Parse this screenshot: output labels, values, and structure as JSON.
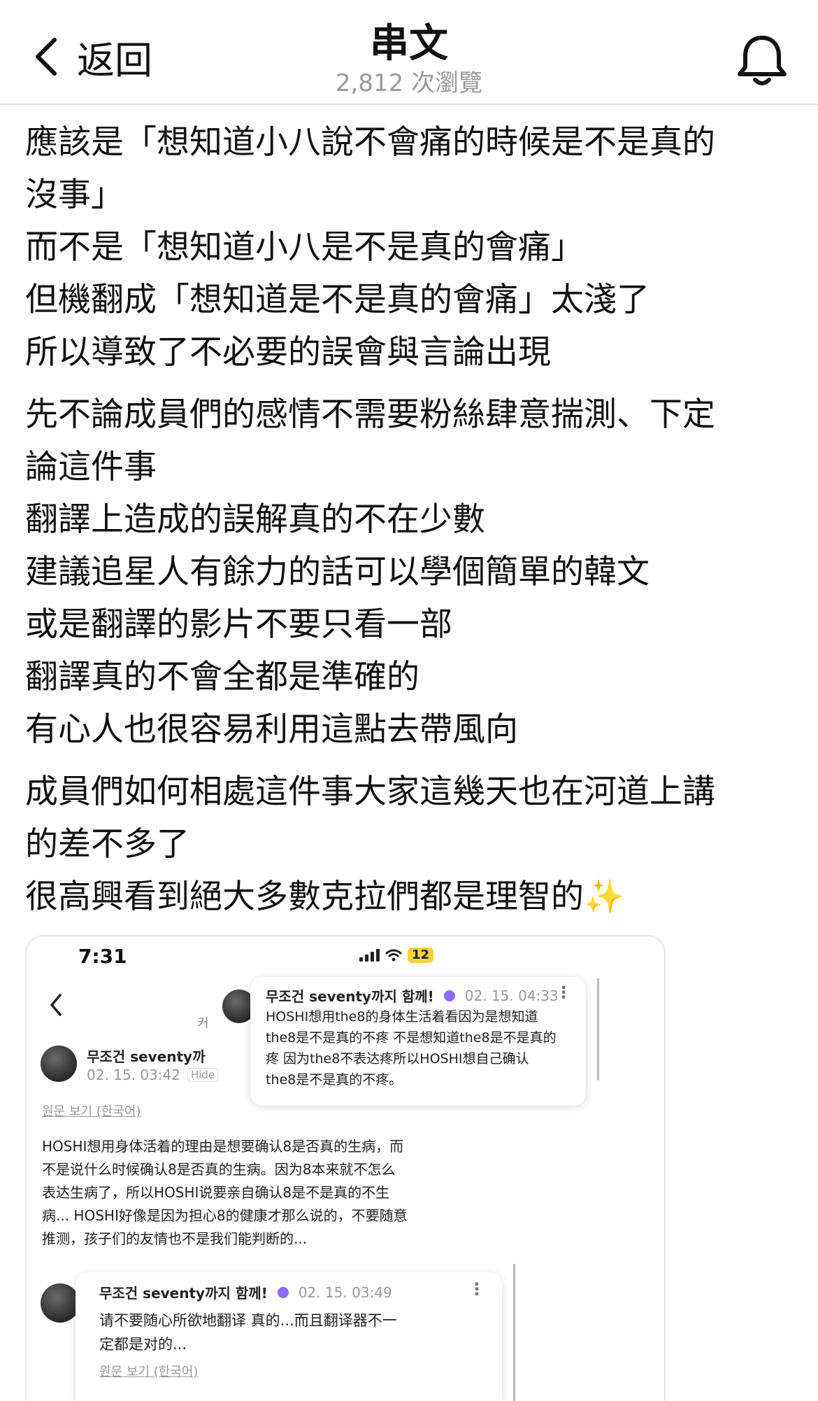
{
  "header": {
    "back_label": "返回",
    "title": "串文",
    "views": "2,812 次瀏覽"
  },
  "post": {
    "paragraphs": [
      [
        "應該是「想知道小八說不會痛的時候是不是真的",
        "沒事」",
        "而不是「想知道小八是不是真的會痛」",
        "但機翻成「想知道是不是真的會痛」太淺了",
        "所以導致了不必要的誤會與言論出現"
      ],
      [
        "先不論成員們的感情不需要粉絲肆意揣測、下定",
        "論這件事",
        "翻譯上造成的誤解真的不在少數",
        "建議追星人有餘力的話可以學個簡單的韓文",
        "或是翻譯的影片不要只看一部",
        "翻譯真的不會全都是準確的",
        "有心人也很容易利用這點去帶風向"
      ],
      [
        "成員們如何相處這件事大家這幾天也在河道上講",
        "的差不多了",
        "很高興看到絕大多數克拉們都是理智的"
      ]
    ],
    "sparkle_emoji": "✨"
  },
  "screenshot": {
    "time": "7:31",
    "battery": "12",
    "ghost_char": "커",
    "comment_left": {
      "name": "무조건 seventy까",
      "time": "02. 15. 03:42",
      "badge": "Hide"
    },
    "orig_link_1": "원문 보기 (한국어)",
    "reply_top": {
      "name": "무조건 seventy까지 함께!",
      "time": "02. 15. 04:33",
      "lines": [
        "HOSHI想用the8的身体生活着看因为是想知道",
        "the8是不是真的不疼  不是想知道the8是不是真的",
        "疼  因为the8不表达疼所以HOSHI想自己确认",
        "the8是不是真的不疼。"
      ]
    },
    "body_lines": [
      "HOSHI想用身体活着的理由是想要确认8是否真的生病，而",
      "不是说什么时候确认8是否真的生病。因为8本来就不怎么",
      "表达生病了，所以HOSHI说要亲自确认8是不是真的不生",
      "病... HOSHI好像是因为担心8的健康才那么说的，不要随意",
      "推测，孩子们的友情也不是我们能判断的..."
    ],
    "reply_bottom": {
      "name": "무조건 seventy까지 함께!",
      "time": "02. 15. 03:49",
      "lines": [
        "请不要随心所欲地翻译 真的...而且翻译器不一",
        "定都是对的..."
      ],
      "orig_link": "원문 보기 (한국어)"
    }
  }
}
